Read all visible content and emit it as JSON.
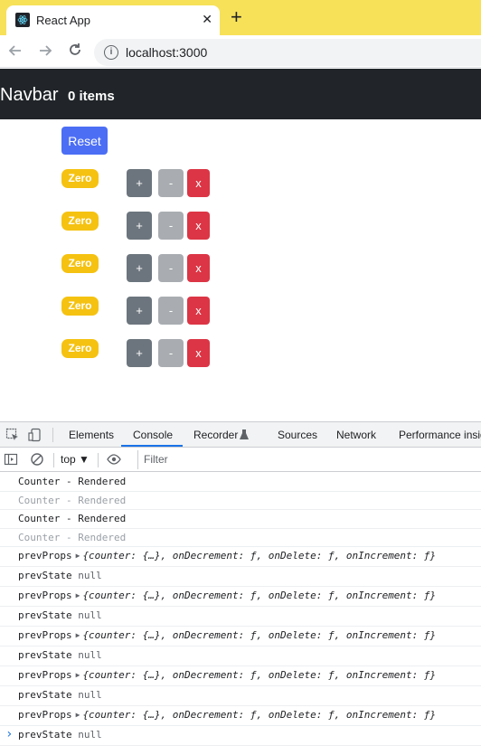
{
  "browser": {
    "tab_title": "React App",
    "new_tab_symbol": "+",
    "close_symbol": "✕",
    "url": "localhost:3000"
  },
  "navbar": {
    "brand": "Navbar",
    "item_count": "0 items"
  },
  "app": {
    "reset_label": "Reset",
    "counters": [
      {
        "value_label": "Zero",
        "inc_label": "+",
        "dec_label": "-",
        "delete_label": "x"
      },
      {
        "value_label": "Zero",
        "inc_label": "+",
        "dec_label": "-",
        "delete_label": "x"
      },
      {
        "value_label": "Zero",
        "inc_label": "+",
        "dec_label": "-",
        "delete_label": "x"
      },
      {
        "value_label": "Zero",
        "inc_label": "+",
        "dec_label": "-",
        "delete_label": "x"
      },
      {
        "value_label": "Zero",
        "inc_label": "+",
        "dec_label": "-",
        "delete_label": "x"
      }
    ],
    "colors": {
      "reset": "#4c6ef5",
      "badge_warning": "#f5c211",
      "increment": "#6c757d",
      "decrement": "#a9adb1",
      "delete": "#dc3545"
    }
  },
  "devtools": {
    "tabs": [
      "Elements",
      "Console",
      "Recorder",
      "Sources",
      "Network",
      "Performance insig"
    ],
    "active_tab": "Console",
    "context": "top ▼",
    "filter_placeholder": "Filter",
    "logs": [
      {
        "text": "Counter - Rendered",
        "faded": false
      },
      {
        "text": "Counter - Rendered",
        "faded": true
      },
      {
        "text": "Counter - Rendered",
        "faded": false
      },
      {
        "text": "Counter - Rendered",
        "faded": true
      },
      {
        "label": "prevProps",
        "object": "{counter: {…}, onDecrement: ƒ, onDelete: ƒ, onIncrement: ƒ}"
      },
      {
        "label": "prevState",
        "value": "null"
      },
      {
        "label": "prevProps",
        "object": "{counter: {…}, onDecrement: ƒ, onDelete: ƒ, onIncrement: ƒ}"
      },
      {
        "label": "prevState",
        "value": "null"
      },
      {
        "label": "prevProps",
        "object": "{counter: {…}, onDecrement: ƒ, onDelete: ƒ, onIncrement: ƒ}"
      },
      {
        "label": "prevState",
        "value": "null"
      },
      {
        "label": "prevProps",
        "object": "{counter: {…}, onDecrement: ƒ, onDelete: ƒ, onIncrement: ƒ}"
      },
      {
        "label": "prevState",
        "value": "null"
      },
      {
        "label": "prevProps",
        "object": "{counter: {…}, onDecrement: ƒ, onDelete: ƒ, onIncrement: ƒ}"
      },
      {
        "label": "prevState",
        "value": "null"
      }
    ],
    "prompt_symbol": "›"
  }
}
